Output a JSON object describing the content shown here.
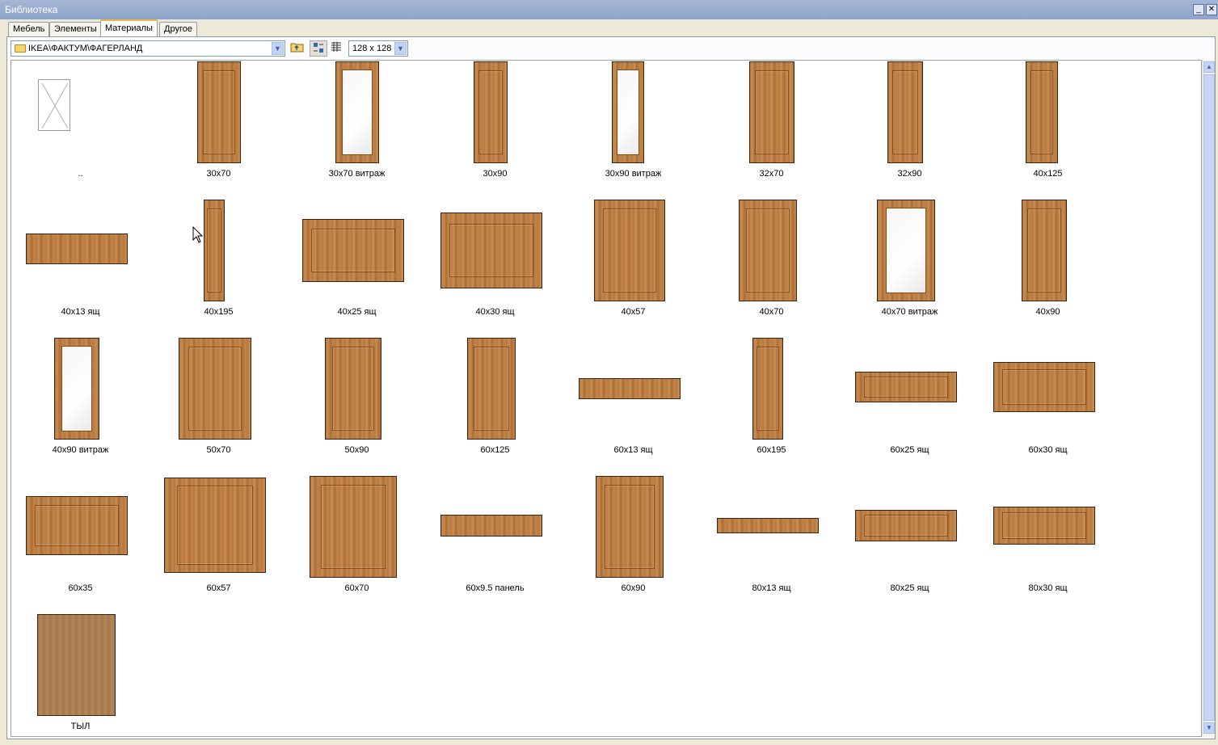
{
  "window": {
    "title": "Библиотека",
    "minimize": "_",
    "close": "✕"
  },
  "tabs": [
    "Мебель",
    "Элементы",
    "Материалы",
    "Другое"
  ],
  "active_tab": "Материалы",
  "toolbar": {
    "path": "IKEA\\ФАКТУМ\\ФАГЕРЛАНД",
    "up_folder_icon": "folder-up-icon",
    "large_icons_icon": "large-icons-view-icon",
    "list_icon": "details-view-icon",
    "thumb_size": "128 x 128"
  },
  "items": [
    {
      "label": "..",
      "kind": "up"
    },
    {
      "label": "30x70",
      "kind": "door"
    },
    {
      "label": "30x70 витраж",
      "kind": "glass"
    },
    {
      "label": "30x90",
      "kind": "door"
    },
    {
      "label": "30x90 витраж",
      "kind": "glass"
    },
    {
      "label": "32x70",
      "kind": "door"
    },
    {
      "label": "32x90",
      "kind": "door"
    },
    {
      "label": "40x125",
      "kind": "door"
    },
    {
      "label": "40x13 ящ",
      "kind": "flat"
    },
    {
      "label": "40x195",
      "kind": "door"
    },
    {
      "label": "40x25 ящ",
      "kind": "wide"
    },
    {
      "label": "40x30 ящ",
      "kind": "wide"
    },
    {
      "label": "40x57",
      "kind": "door"
    },
    {
      "label": "40x70",
      "kind": "door"
    },
    {
      "label": "40x70 витраж",
      "kind": "glass"
    },
    {
      "label": "40x90",
      "kind": "door"
    },
    {
      "label": "40x90 витраж",
      "kind": "glass"
    },
    {
      "label": "50x70",
      "kind": "door"
    },
    {
      "label": "50x90",
      "kind": "door"
    },
    {
      "label": "60x125",
      "kind": "door"
    },
    {
      "label": "60x13 ящ",
      "kind": "flat"
    },
    {
      "label": "60x195",
      "kind": "door"
    },
    {
      "label": "60x25 ящ",
      "kind": "wide"
    },
    {
      "label": "60x30 ящ",
      "kind": "wide"
    },
    {
      "label": "60x35",
      "kind": "wide"
    },
    {
      "label": "60x57",
      "kind": "door"
    },
    {
      "label": "60x70",
      "kind": "door"
    },
    {
      "label": "60x9.5 панель",
      "kind": "flat"
    },
    {
      "label": "60x90",
      "kind": "door"
    },
    {
      "label": "80x13 ящ",
      "kind": "flat"
    },
    {
      "label": "80x25 ящ",
      "kind": "wide"
    },
    {
      "label": "80x30 ящ",
      "kind": "wide"
    },
    {
      "label": "ТЫЛ",
      "kind": "plain"
    }
  ]
}
